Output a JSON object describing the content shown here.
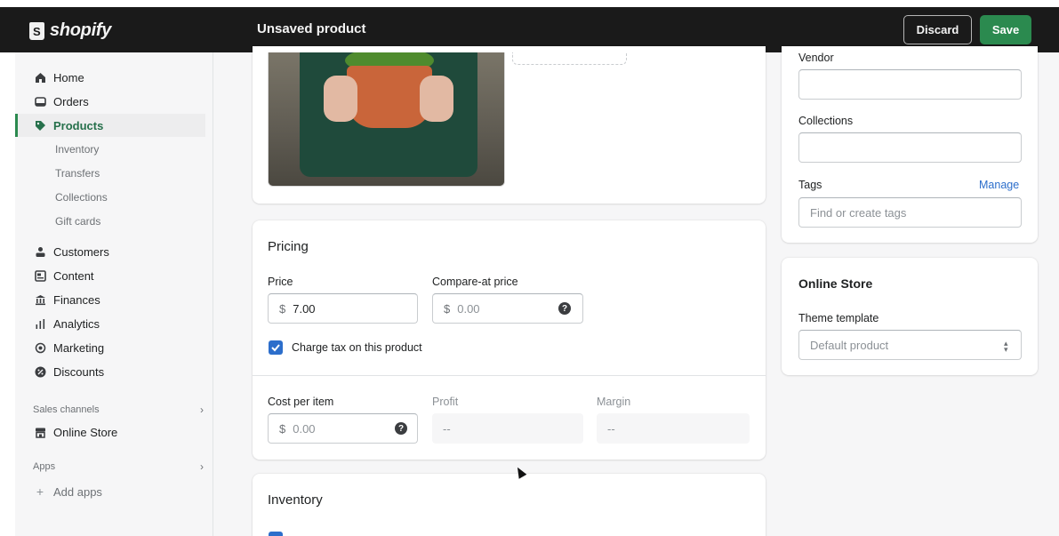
{
  "topbar": {
    "logo_text": "shopify",
    "page_title": "Unsaved product",
    "discard_label": "Discard",
    "save_label": "Save"
  },
  "sidebar": {
    "items": [
      {
        "label": "Home",
        "icon": "home-icon"
      },
      {
        "label": "Orders",
        "icon": "orders-icon"
      },
      {
        "label": "Products",
        "icon": "tag-icon",
        "active": true
      },
      {
        "label": "Customers",
        "icon": "person-icon"
      },
      {
        "label": "Content",
        "icon": "content-icon"
      },
      {
        "label": "Finances",
        "icon": "bank-icon"
      },
      {
        "label": "Analytics",
        "icon": "bar-chart-icon"
      },
      {
        "label": "Marketing",
        "icon": "target-icon"
      },
      {
        "label": "Discounts",
        "icon": "discount-icon"
      }
    ],
    "product_subitems": [
      "Inventory",
      "Transfers",
      "Collections",
      "Gift cards"
    ],
    "sales_channels_label": "Sales channels",
    "online_store_label": "Online Store",
    "apps_label": "Apps",
    "add_apps_label": "Add apps"
  },
  "pricing": {
    "title": "Pricing",
    "price_label": "Price",
    "price_prefix": "$",
    "price_value": "7.00",
    "compare_label": "Compare-at price",
    "compare_prefix": "$",
    "compare_placeholder": "0.00",
    "charge_tax_label": "Charge tax on this product",
    "charge_tax_checked": true,
    "cost_label": "Cost per item",
    "cost_prefix": "$",
    "cost_placeholder": "0.00",
    "profit_label": "Profit",
    "profit_value": "--",
    "margin_label": "Margin",
    "margin_value": "--"
  },
  "inventory": {
    "title": "Inventory"
  },
  "organization": {
    "vendor_label": "Vendor",
    "vendor_value": "",
    "collections_label": "Collections",
    "collections_value": "",
    "tags_label": "Tags",
    "tags_manage_label": "Manage",
    "tags_placeholder": "Find or create tags"
  },
  "online_store": {
    "title": "Online Store",
    "theme_template_label": "Theme template",
    "theme_template_value": "Default product"
  },
  "colors": {
    "accent_green": "#2b8a4f",
    "link_blue": "#2c6ecb",
    "topbar_bg": "#1a1a1a"
  }
}
